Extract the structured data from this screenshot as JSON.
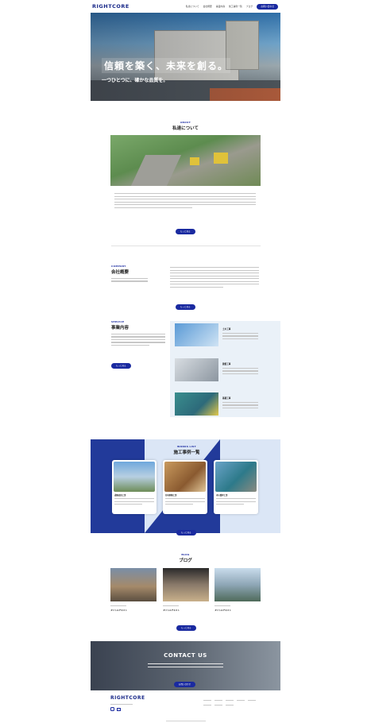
{
  "header": {
    "logo": "RIGHTCORE",
    "nav": [
      "私達について",
      "会社概要",
      "事業内容",
      "施工事例一覧",
      "ブログ"
    ],
    "contact_button": "お問い合わせ"
  },
  "hero": {
    "title": "信頼を築く、未来を創る。",
    "subtitle": "一つひとつに、確かな品質を。"
  },
  "about": {
    "sub": "ABOUT",
    "title": "私達について",
    "button": "もっと見る"
  },
  "company": {
    "sub": "COMPANY",
    "title": "会社概要",
    "button": "もっと見る"
  },
  "service": {
    "sub": "SERVICE",
    "title": "事業内容",
    "button": "もっと見る",
    "items": [
      {
        "title": "土木工事"
      },
      {
        "title": "建築工事"
      },
      {
        "title": "基礎工事"
      }
    ]
  },
  "works": {
    "sub": "WORKS LIST",
    "title": "施工事例一覧",
    "button": "もっと見る",
    "items": [
      {
        "title": "道路改良工事"
      },
      {
        "title": "住宅新築工事"
      },
      {
        "title": "河川護岸工事"
      }
    ]
  },
  "blog": {
    "sub": "BLOG",
    "title": "ブログ",
    "button": "もっと見る",
    "items": [
      {
        "title": "タイトルテキスト"
      },
      {
        "title": "タイトルテキスト"
      },
      {
        "title": "タイトルテキスト"
      }
    ]
  },
  "contact": {
    "title": "CONTACT US",
    "button": "お問い合わせ"
  },
  "footer": {
    "logo": "RIGHTCORE"
  },
  "colors": {
    "accent": "#1a2aa0",
    "works_blue": "#223a9a"
  }
}
